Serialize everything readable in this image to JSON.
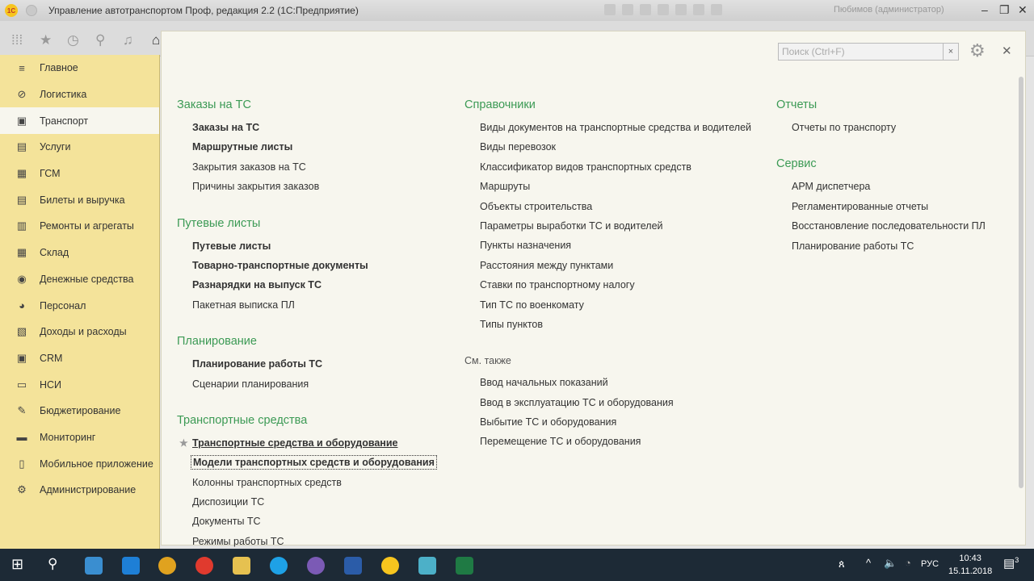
{
  "window": {
    "title": "Управление автотранспортом Проф, редакция 2.2  (1С:Предприятие)",
    "user": "Пюбимов (администратор)",
    "logo": "1С"
  },
  "sidebar": {
    "items": [
      {
        "label": "Главное",
        "icon": "≡"
      },
      {
        "label": "Логистика",
        "icon": "⊘"
      },
      {
        "label": "Транспорт",
        "icon": "▣",
        "active": true
      },
      {
        "label": "Услуги",
        "icon": "▤"
      },
      {
        "label": "ГСМ",
        "icon": "▦"
      },
      {
        "label": "Билеты и выручка",
        "icon": "▤"
      },
      {
        "label": "Ремонты и агрегаты",
        "icon": "▥"
      },
      {
        "label": "Склад",
        "icon": "▦"
      },
      {
        "label": "Денежные средства",
        "icon": "◉"
      },
      {
        "label": "Персонал",
        "icon": "◕"
      },
      {
        "label": "Доходы и расходы",
        "icon": "▧"
      },
      {
        "label": "CRM",
        "icon": "▣"
      },
      {
        "label": "НСИ",
        "icon": "▭"
      },
      {
        "label": "Бюджетирование",
        "icon": "✎"
      },
      {
        "label": "Мониторинг",
        "icon": "▬"
      },
      {
        "label": "Мобильное приложение",
        "icon": "▯"
      },
      {
        "label": "Администрирование",
        "icon": "⚙"
      }
    ]
  },
  "search": {
    "placeholder": "Поиск (Ctrl+F)",
    "clear": "×"
  },
  "columns": [
    [
      {
        "title": "Заказы на ТС",
        "items": [
          {
            "label": "Заказы на ТС",
            "bold": true
          },
          {
            "label": "Маршрутные листы",
            "bold": true
          },
          {
            "label": "Закрытия заказов на ТС"
          },
          {
            "label": "Причины закрытия заказов"
          }
        ]
      },
      {
        "title": "Путевые листы",
        "items": [
          {
            "label": "Путевые листы",
            "bold": true
          },
          {
            "label": "Товарно-транспортные документы",
            "bold": true
          },
          {
            "label": "Разнарядки на выпуск ТС",
            "bold": true
          },
          {
            "label": "Пакетная выписка ПЛ"
          }
        ]
      },
      {
        "title": "Планирование",
        "items": [
          {
            "label": "Планирование работы ТС",
            "bold": true
          },
          {
            "label": "Сценарии планирования"
          }
        ]
      },
      {
        "title": "Транспортные средства",
        "items": [
          {
            "label": "Транспортные средства и оборудование",
            "bold": true,
            "fav": true
          },
          {
            "label": "Модели транспортных средств и оборудования",
            "bold": true,
            "focus": true
          },
          {
            "label": "Колонны транспортных средств"
          },
          {
            "label": "Диспозиции ТС"
          },
          {
            "label": "Документы ТС"
          },
          {
            "label": "Режимы работы ТС"
          }
        ]
      }
    ],
    [
      {
        "title": "Справочники",
        "items": [
          {
            "label": "Виды документов на транспортные средства и водителей"
          },
          {
            "label": "Виды перевозок"
          },
          {
            "label": "Классификатор видов транспортных средств"
          },
          {
            "label": "Маршруты"
          },
          {
            "label": "Объекты строительства"
          },
          {
            "label": "Параметры выработки ТС и водителей"
          },
          {
            "label": "Пункты назначения"
          },
          {
            "label": "Расстояния между пунктами"
          },
          {
            "label": "Ставки по транспортному налогу"
          },
          {
            "label": "Тип ТС по военкомату"
          },
          {
            "label": "Типы пунктов"
          }
        ]
      },
      {
        "title": "См. также",
        "small": true,
        "items": [
          {
            "label": "Ввод начальных показаний"
          },
          {
            "label": "Ввод в эксплуатацию ТС и оборудования"
          },
          {
            "label": "Выбытие ТС и оборудования"
          },
          {
            "label": "Перемещение ТС и оборудования"
          }
        ]
      }
    ],
    [
      {
        "title": "Отчеты",
        "items": [
          {
            "label": "Отчеты по транспорту"
          }
        ]
      },
      {
        "title": "Сервис",
        "items": [
          {
            "label": "АРМ диспетчера"
          },
          {
            "label": "Регламентированные отчеты"
          },
          {
            "label": "Восстановление последовательности ПЛ"
          },
          {
            "label": "Планирование работы ТС"
          }
        ]
      }
    ]
  ],
  "tray": {
    "lang": "РУС",
    "time": "10:43",
    "date": "15.11.2018",
    "notifications": "3"
  },
  "colors": {
    "accent": "#3c9a55",
    "sidebar": "#f4e39a",
    "panel": "#f7f6ee"
  }
}
